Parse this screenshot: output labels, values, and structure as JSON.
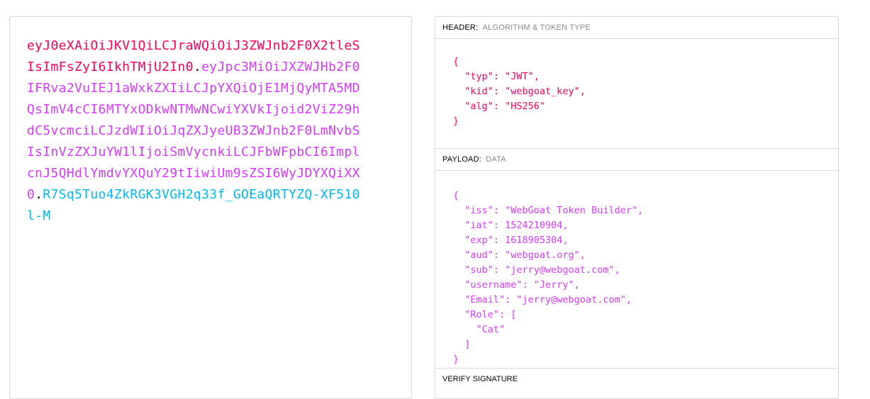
{
  "encoded": {
    "header_part": "eyJ0eXAiOiJKV1QiLCJraWQiOiJ3ZWJnb2F0X2tleSIsImFsZyI6IkhTMjU2In0",
    "payload_part": "eyJpc3MiOiJXZWJHb2F0IFRva2VuIEJ1aWxkZXIiLCJpYXQiOjE1MjQyMTA5MDQsImV4cCI6MTYxODkwNTMwNCwiYXVkIjoid2ViZ29hdC5vcmciLCJzdWIiOiJqZXJyeUB3ZWJnb2F0LmNvbSIsInVzZXJuYW1lIjoiSmVycnkiLCJFbWFpbCI6ImplcnJ5QHdlYmdvYXQuY29tIiwiUm9sZSI6WyJDYXQiXX0",
    "signature_part": "R7Sq5Tuo4ZkRGK3VGH2q33f_GOEaQRTYZQ-XF510l-M",
    "dot": "."
  },
  "decoded": {
    "header_section": {
      "title": "HEADER:",
      "subtitle": "ALGORITHM & TOKEN TYPE",
      "json_text": "{\n  \"typ\": \"JWT\",\n  \"kid\": \"webgoat_key\",\n  \"alg\": \"HS256\"\n}"
    },
    "payload_section": {
      "title": "PAYLOAD:",
      "subtitle": "DATA",
      "json_text": "{\n  \"iss\": \"WebGoat Token Builder\",\n  \"iat\": 1524210904,\n  \"exp\": 1618905304,\n  \"aud\": \"webgoat.org\",\n  \"sub\": \"jerry@webgoat.com\",\n  \"username\": \"Jerry\",\n  \"Email\": \"jerry@webgoat.com\",\n  \"Role\": [\n    \"Cat\"\n  ]\n}"
    },
    "verify_section": {
      "title": "VERIFY SIGNATURE"
    }
  },
  "colors": {
    "header": "#fb015b",
    "payload": "#d63aff",
    "signature": "#00b9f1"
  }
}
